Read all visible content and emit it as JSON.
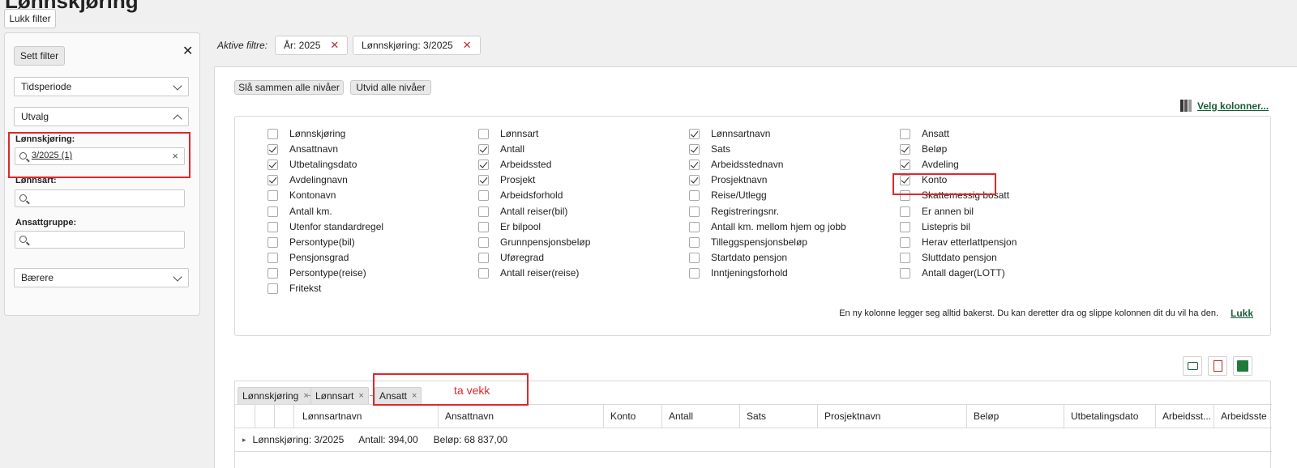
{
  "top": {
    "close_filter_label": "Lukk filter"
  },
  "filter_panel": {
    "set_filter_label": "Sett filter",
    "close_symbol": "✕",
    "period_select": "Tidsperiode",
    "selection_select": "Utvalg",
    "payroll_label": "Lønnskjøring:",
    "payroll_value": "3/2025 (1)",
    "clear_symbol": "×",
    "wage_type_label": "Lønnsart:",
    "employee_group_label": "Ansattgruppe:",
    "carriers_select": "Bærere"
  },
  "active_filters": {
    "label": "Aktive filtre:",
    "chips": [
      {
        "label": "År: 2025",
        "x": "✕"
      },
      {
        "label": "Lønnskjøring: 3/2025",
        "x": "✕"
      }
    ]
  },
  "toolbar": {
    "collapse_all": "Slå sammen alle nivåer",
    "expand_all": "Utvid alle nivåer",
    "choose_columns": "Velg kolonner..."
  },
  "columns": [
    [
      {
        "label": "Lønnskjøring",
        "checked": false
      },
      {
        "label": "Ansattnavn",
        "checked": true
      },
      {
        "label": "Utbetalingsdato",
        "checked": true
      },
      {
        "label": "Avdelingnavn",
        "checked": true
      },
      {
        "label": "Kontonavn",
        "checked": false
      },
      {
        "label": "Antall km.",
        "checked": false
      },
      {
        "label": "Utenfor standardregel",
        "checked": false
      },
      {
        "label": "Persontype(bil)",
        "checked": false
      },
      {
        "label": "Pensjonsgrad",
        "checked": false
      },
      {
        "label": "Persontype(reise)",
        "checked": false
      },
      {
        "label": "Fritekst",
        "checked": false
      }
    ],
    [
      {
        "label": "Lønnsart",
        "checked": false
      },
      {
        "label": "Antall",
        "checked": true
      },
      {
        "label": "Arbeidssted",
        "checked": true
      },
      {
        "label": "Prosjekt",
        "checked": true
      },
      {
        "label": "Arbeidsforhold",
        "checked": false
      },
      {
        "label": "Antall reiser(bil)",
        "checked": false
      },
      {
        "label": "Er bilpool",
        "checked": false
      },
      {
        "label": "Grunnpensjonsbeløp",
        "checked": false
      },
      {
        "label": "Uføregrad",
        "checked": false
      },
      {
        "label": "Antall reiser(reise)",
        "checked": false
      }
    ],
    [
      {
        "label": "Lønnsartnavn",
        "checked": true
      },
      {
        "label": "Sats",
        "checked": true
      },
      {
        "label": "Arbeidsstednavn",
        "checked": true
      },
      {
        "label": "Prosjektnavn",
        "checked": true
      },
      {
        "label": "Reise/Utlegg",
        "checked": false
      },
      {
        "label": "Registreringsnr.",
        "checked": false
      },
      {
        "label": "Antall km. mellom hjem og jobb",
        "checked": false
      },
      {
        "label": "Tilleggspensjonsbeløp",
        "checked": false
      },
      {
        "label": "Startdato pensjon",
        "checked": false
      },
      {
        "label": "Inntjeningsforhold",
        "checked": false
      }
    ],
    [
      {
        "label": "Ansatt",
        "checked": false
      },
      {
        "label": "Beløp",
        "checked": true
      },
      {
        "label": "Avdeling",
        "checked": true
      },
      {
        "label": "Konto",
        "checked": true
      },
      {
        "label": "Skattemessig bosatt",
        "checked": false
      },
      {
        "label": "Er annen bil",
        "checked": false
      },
      {
        "label": "Listepris bil",
        "checked": false
      },
      {
        "label": "Herav etterlattpensjon",
        "checked": false
      },
      {
        "label": "Sluttdato pensjon",
        "checked": false
      },
      {
        "label": "Antall dager(LOTT)",
        "checked": false
      }
    ]
  ],
  "columns_note": "En ny kolonne legger seg alltid bakerst. Du kan deretter dra og slippe kolonnen dit du vil ha den.",
  "columns_close": "Lukk",
  "grouping": {
    "chips": [
      "Lønnskjøring",
      "Lønnsart",
      "Ansatt"
    ],
    "x": "×",
    "annotation": "ta vekk"
  },
  "grid_headers": [
    "Lønnsartnavn",
    "Ansattnavn",
    "Konto",
    "Antall",
    "Sats",
    "Prosjektnavn",
    "Beløp",
    "Utbetalingsdato",
    "Arbeidsst...",
    "Arbeidsste"
  ],
  "group_row": {
    "expander": "▸",
    "label": "Lønnskjøring: 3/2025",
    "count": "Antall: 394,00",
    "amount": "Beløp: 68 837,00"
  },
  "colors": {
    "highlight": "#e2262a",
    "remove_x": "#c0272d",
    "link": "#1a5c38"
  }
}
